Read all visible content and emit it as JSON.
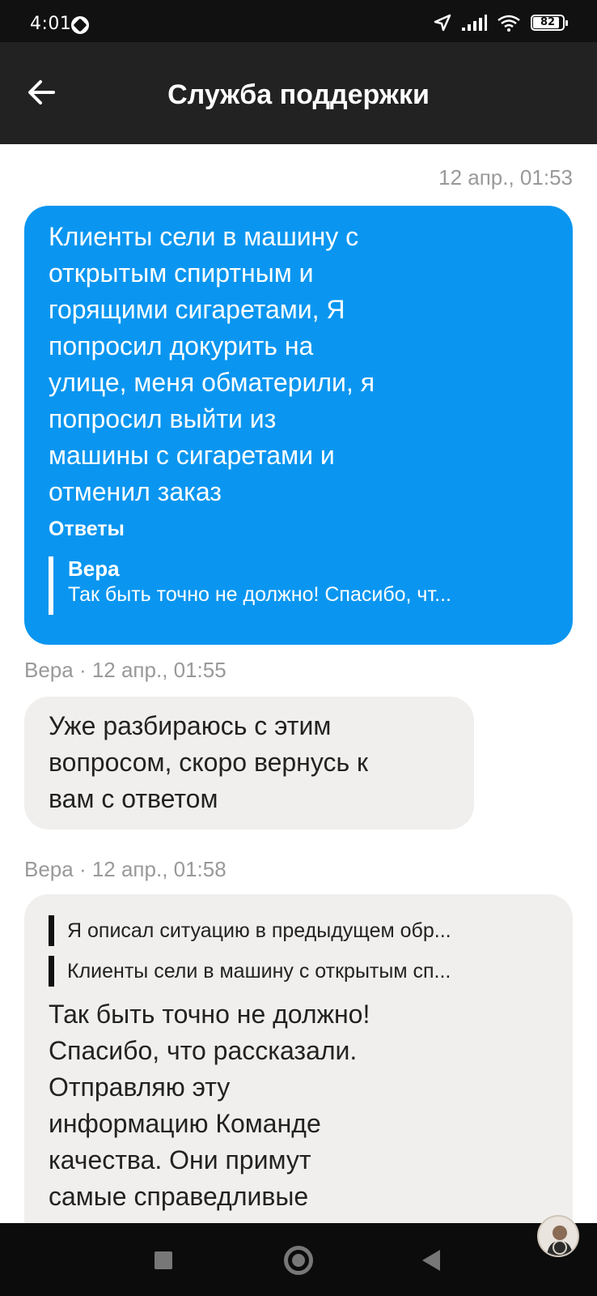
{
  "status_bar": {
    "time": "4:01",
    "battery": "82"
  },
  "header": {
    "title": "Служба поддержки"
  },
  "messages": {
    "outgoing": {
      "timestamp": "12 апр., 01:53",
      "lines": [
        "Клиенты сели в машину с",
        "открытым спиртным и",
        "горящими сигаретами, Я",
        "попросил докурить на",
        "улице, меня обматерили, я",
        "попросил выйти из",
        "машины с сигаретами и",
        "отменил заказ"
      ],
      "replies_label": "Ответы",
      "reply": {
        "name": "Вера",
        "text": "Так быть точно не должно! Спасибо, чт..."
      }
    },
    "incoming_1": {
      "meta": "Вера · 12 апр., 01:55",
      "lines": [
        "Уже разбираюсь с этим",
        "вопросом, скоро вернусь к",
        "вам с ответом"
      ]
    },
    "incoming_2": {
      "meta": "Вера · 12 апр., 01:58",
      "quotes": [
        "Я описал ситуацию в предыдущем обр...",
        "Клиенты сели в машину с открытым сп..."
      ],
      "lines": [
        "Так быть точно не должно!",
        "Спасибо, что рассказали.",
        "Отправляю эту",
        "информацию Команде",
        "качества. Они примут",
        "самые справедливые"
      ]
    }
  },
  "colors": {
    "outgoing_bubble": "#0a96f0",
    "incoming_bubble": "#f0efed",
    "header": "#222222"
  },
  "icons": {
    "back": "arrow-left-icon",
    "location": "navigation-arrow-icon",
    "signal": "signal-bars-icon",
    "wifi": "wifi-icon",
    "battery": "battery-icon",
    "assistant": "assistant-avatar-icon"
  }
}
